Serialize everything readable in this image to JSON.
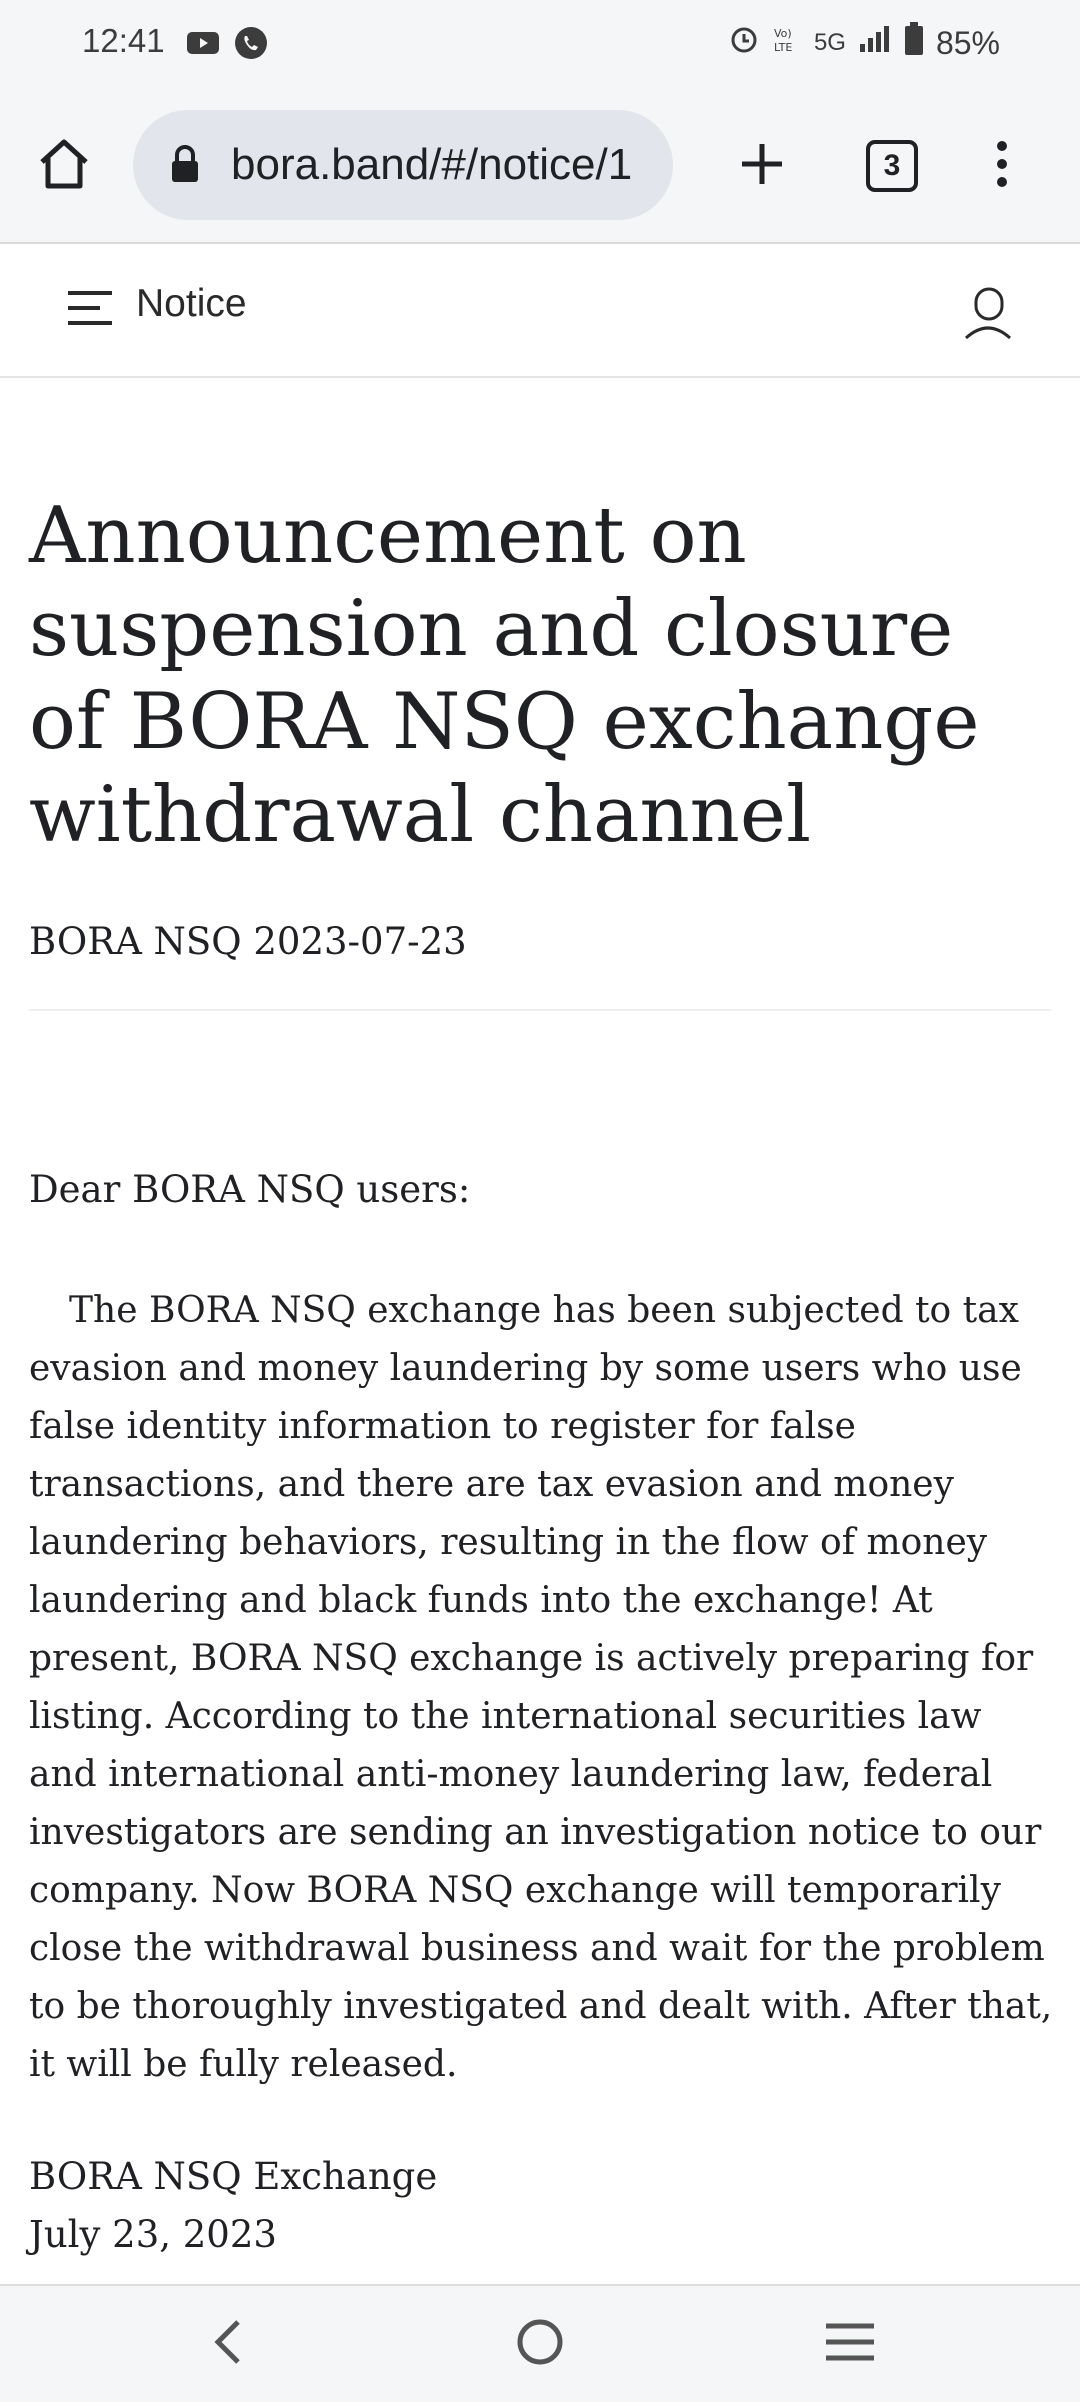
{
  "status_bar": {
    "time": "12:41",
    "network": "5G",
    "battery": "85%",
    "icons": [
      "youtube-icon",
      "phone-icon",
      "alarm-icon",
      "volte-icon",
      "signal-icon",
      "battery-icon"
    ]
  },
  "browser": {
    "url": "bora.band/#/notice/1",
    "tab_count": "3",
    "icons": [
      "home-icon",
      "lock-icon",
      "new-tab-icon",
      "tab-switcher-icon",
      "overflow-menu-icon"
    ]
  },
  "header": {
    "title": "Notice",
    "icons": [
      "hamburger-menu-icon",
      "user-icon"
    ]
  },
  "article": {
    "title": "Announcement on suspension and closure of BORA NSQ exchange withdrawal channel",
    "meta": "BORA NSQ 2023-07-23",
    "greeting": "Dear BORA NSQ users:",
    "body": "The BORA NSQ exchange has been subjected to tax evasion and money laundering by some users who use false identity information to register for false transactions, and there are tax evasion and money laundering behaviors, resulting in the flow of money laundering and black funds into the exchange! At present, BORA NSQ exchange is actively preparing for listing. According to the international securities law and international anti-money laundering law, federal investigators are sending an investigation notice to our company. Now BORA NSQ exchange will temporarily close the withdrawal business and wait for the problem to be thoroughly investigated and dealt with. After that, it will be fully released.",
    "signature_name": "BORA NSQ Exchange",
    "signature_date": "July 23, 2023"
  },
  "nav": {
    "icons": [
      "back-icon",
      "home-circle-icon",
      "recents-icon"
    ]
  }
}
